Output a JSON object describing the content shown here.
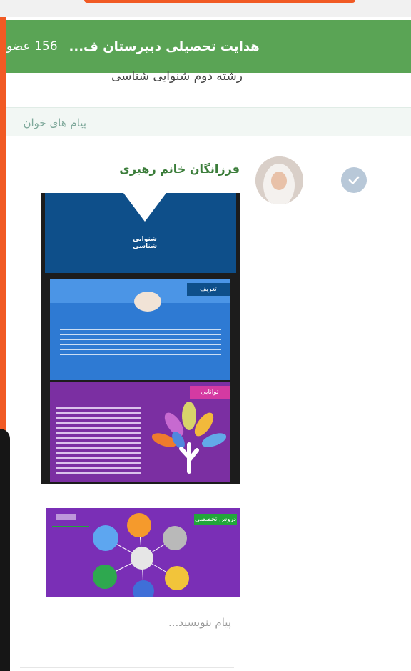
{
  "header": {
    "title": "هدایت تحصیلی دبیرستان ف...",
    "members": "156 عضو"
  },
  "subtitle": "رشته دوم شنوایی شناسی",
  "unread_label": "پیام های خوان",
  "message": {
    "sender": "فرزانگان خانم رهبری",
    "slide1": {
      "title": "شنوایی شناسی",
      "section1": "تعریف",
      "section2": "توانایی"
    },
    "slide2": {
      "label": "دروس تخصصی"
    }
  },
  "composer": {
    "placeholder": "پیام بنویسید..."
  },
  "colors": {
    "header": "#5aa455",
    "accent": "#f15a24",
    "sender": "#3b7d3a"
  }
}
